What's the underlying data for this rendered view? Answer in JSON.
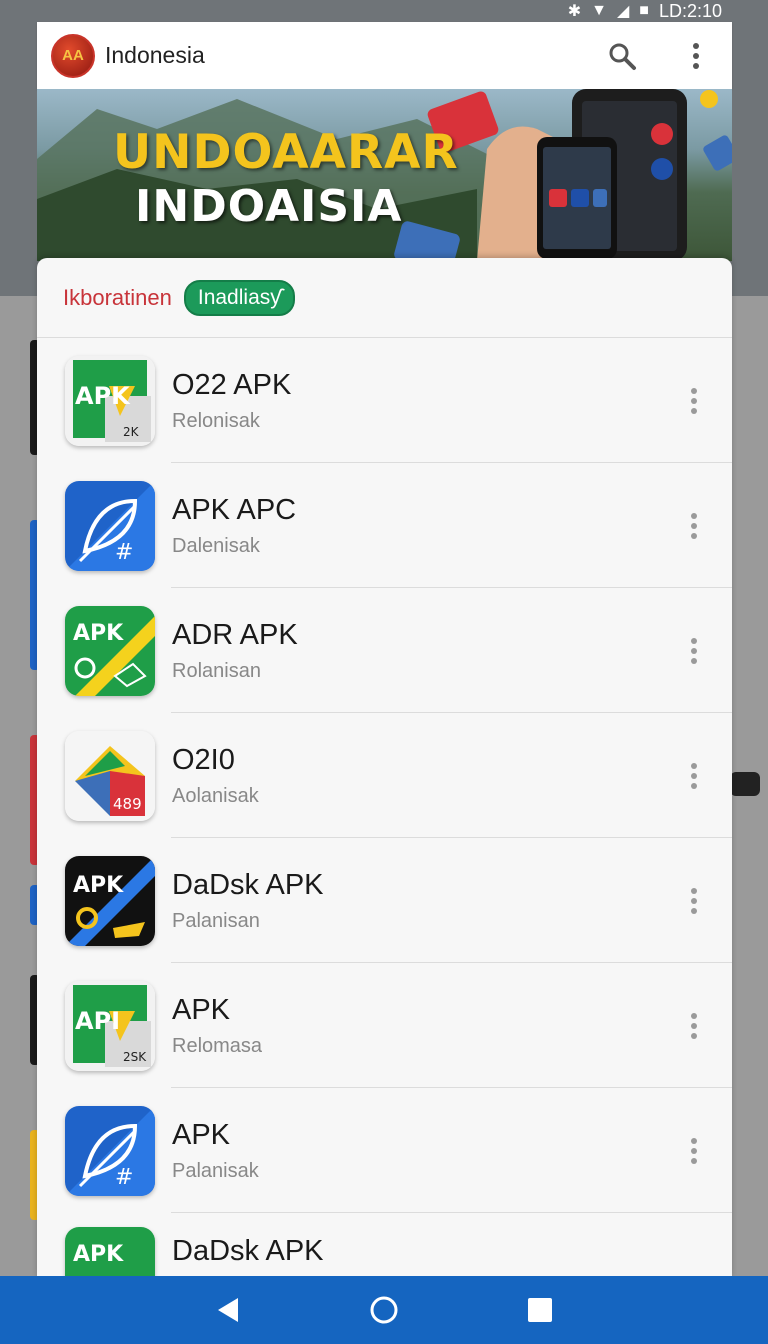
{
  "status_bar": {
    "time": "LD:2:10"
  },
  "header": {
    "logo_text": "AA",
    "title": "Indonesia",
    "search_icon": "search-icon",
    "menu_icon": "more-vert-icon"
  },
  "banner": {
    "title_line1": "UNDOAARAR",
    "title_line2": "INDOAISIA"
  },
  "sheet": {
    "label": "Ikboratinen",
    "chip": "Inadliasƴ"
  },
  "apps": [
    {
      "title": "O22 APK",
      "subtitle": "Relonisak",
      "icon": "apk-green-icon"
    },
    {
      "title": "APK APC",
      "subtitle": "Dalenisak",
      "icon": "apk-blue-icon"
    },
    {
      "title": "ADR APK",
      "subtitle": "Rolanisan",
      "icon": "apk-green-yellow-icon"
    },
    {
      "title": "O2I0",
      "subtitle": "Aolanisak",
      "icon": "apk-multicolor-icon"
    },
    {
      "title": "DaDsk APK",
      "subtitle": "Palanisan",
      "icon": "apk-black-icon"
    },
    {
      "title": "APK",
      "subtitle": "Relomasa",
      "icon": "apk-green-icon"
    },
    {
      "title": "APK",
      "subtitle": "Palanisak",
      "icon": "apk-blue-icon"
    },
    {
      "title": "DaDsk APK",
      "subtitle": "",
      "icon": "apk-green-icon"
    }
  ],
  "nav": {
    "back_icon": "back-icon",
    "home_icon": "home-icon",
    "recents_icon": "recents-icon"
  },
  "colors": {
    "nav_bar": "#1565c0",
    "chip": "#1c9a5a",
    "label": "#c8343a",
    "banner_title": "#f4c41d"
  }
}
